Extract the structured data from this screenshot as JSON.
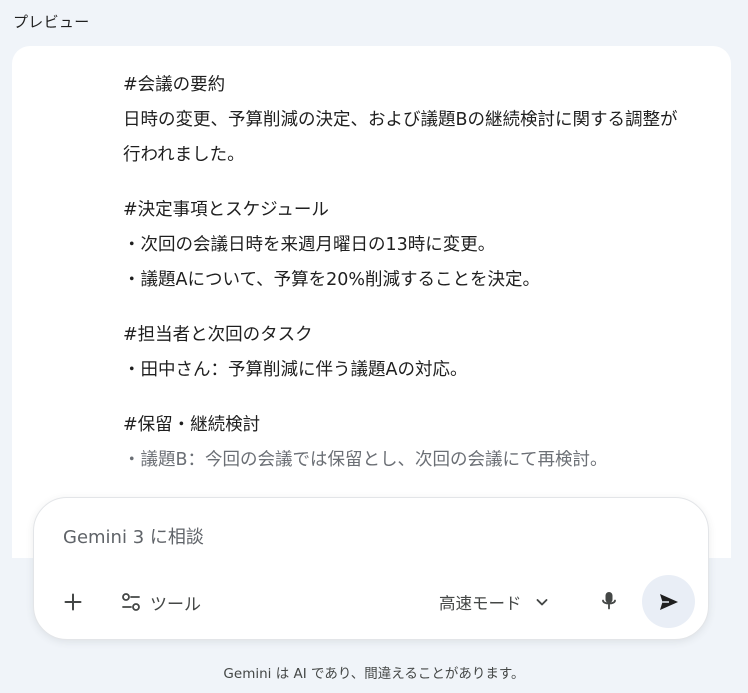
{
  "preview": {
    "label": "プレビュー"
  },
  "summary": {
    "sections": [
      {
        "lines": [
          "#会議の要約",
          "日時の変更、予算削減の決定、および議題Bの継続検討に関する調整が行われました。"
        ]
      },
      {
        "lines": [
          "#決定事項とスケジュール",
          "・次回の会議日時を来週月曜日の13時に変更。",
          "・議題Aについて、予算を20%削減することを決定。"
        ]
      },
      {
        "lines": [
          "#担当者と次回のタスク",
          "・田中さん：予算削減に伴う議題Aの対応。"
        ]
      },
      {
        "lines": [
          "#保留・継続検討",
          "・議題B：今回の会議では保留とし、次回の会議にて再検討。"
        ]
      }
    ]
  },
  "composer": {
    "placeholder": "Gemini 3 に相談",
    "value": "",
    "tools_label": "ツール",
    "mode_label": "高速モード"
  },
  "icons": {
    "add": "plus-icon",
    "tools": "tools-sliders-icon",
    "mode": "chevron-down-icon",
    "mic": "microphone-icon",
    "send": "send-icon"
  },
  "footer": {
    "disclaimer": "Gemini は AI であり、間違えることがあります。"
  },
  "colors": {
    "background": "#f0f4f9",
    "card": "#ffffff",
    "text": "#1f1f1f",
    "muted": "#444746",
    "faded_text": "#6b6f75",
    "send_button_bg": "#e9eef6"
  }
}
